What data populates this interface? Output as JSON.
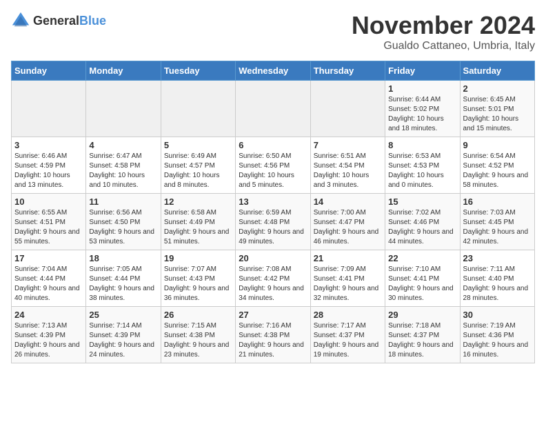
{
  "logo": {
    "general": "General",
    "blue": "Blue"
  },
  "title": "November 2024",
  "location": "Gualdo Cattaneo, Umbria, Italy",
  "days_of_week": [
    "Sunday",
    "Monday",
    "Tuesday",
    "Wednesday",
    "Thursday",
    "Friday",
    "Saturday"
  ],
  "weeks": [
    [
      {
        "day": "",
        "info": ""
      },
      {
        "day": "",
        "info": ""
      },
      {
        "day": "",
        "info": ""
      },
      {
        "day": "",
        "info": ""
      },
      {
        "day": "",
        "info": ""
      },
      {
        "day": "1",
        "info": "Sunrise: 6:44 AM\nSunset: 5:02 PM\nDaylight: 10 hours and 18 minutes."
      },
      {
        "day": "2",
        "info": "Sunrise: 6:45 AM\nSunset: 5:01 PM\nDaylight: 10 hours and 15 minutes."
      }
    ],
    [
      {
        "day": "3",
        "info": "Sunrise: 6:46 AM\nSunset: 4:59 PM\nDaylight: 10 hours and 13 minutes."
      },
      {
        "day": "4",
        "info": "Sunrise: 6:47 AM\nSunset: 4:58 PM\nDaylight: 10 hours and 10 minutes."
      },
      {
        "day": "5",
        "info": "Sunrise: 6:49 AM\nSunset: 4:57 PM\nDaylight: 10 hours and 8 minutes."
      },
      {
        "day": "6",
        "info": "Sunrise: 6:50 AM\nSunset: 4:56 PM\nDaylight: 10 hours and 5 minutes."
      },
      {
        "day": "7",
        "info": "Sunrise: 6:51 AM\nSunset: 4:54 PM\nDaylight: 10 hours and 3 minutes."
      },
      {
        "day": "8",
        "info": "Sunrise: 6:53 AM\nSunset: 4:53 PM\nDaylight: 10 hours and 0 minutes."
      },
      {
        "day": "9",
        "info": "Sunrise: 6:54 AM\nSunset: 4:52 PM\nDaylight: 9 hours and 58 minutes."
      }
    ],
    [
      {
        "day": "10",
        "info": "Sunrise: 6:55 AM\nSunset: 4:51 PM\nDaylight: 9 hours and 55 minutes."
      },
      {
        "day": "11",
        "info": "Sunrise: 6:56 AM\nSunset: 4:50 PM\nDaylight: 9 hours and 53 minutes."
      },
      {
        "day": "12",
        "info": "Sunrise: 6:58 AM\nSunset: 4:49 PM\nDaylight: 9 hours and 51 minutes."
      },
      {
        "day": "13",
        "info": "Sunrise: 6:59 AM\nSunset: 4:48 PM\nDaylight: 9 hours and 49 minutes."
      },
      {
        "day": "14",
        "info": "Sunrise: 7:00 AM\nSunset: 4:47 PM\nDaylight: 9 hours and 46 minutes."
      },
      {
        "day": "15",
        "info": "Sunrise: 7:02 AM\nSunset: 4:46 PM\nDaylight: 9 hours and 44 minutes."
      },
      {
        "day": "16",
        "info": "Sunrise: 7:03 AM\nSunset: 4:45 PM\nDaylight: 9 hours and 42 minutes."
      }
    ],
    [
      {
        "day": "17",
        "info": "Sunrise: 7:04 AM\nSunset: 4:44 PM\nDaylight: 9 hours and 40 minutes."
      },
      {
        "day": "18",
        "info": "Sunrise: 7:05 AM\nSunset: 4:44 PM\nDaylight: 9 hours and 38 minutes."
      },
      {
        "day": "19",
        "info": "Sunrise: 7:07 AM\nSunset: 4:43 PM\nDaylight: 9 hours and 36 minutes."
      },
      {
        "day": "20",
        "info": "Sunrise: 7:08 AM\nSunset: 4:42 PM\nDaylight: 9 hours and 34 minutes."
      },
      {
        "day": "21",
        "info": "Sunrise: 7:09 AM\nSunset: 4:41 PM\nDaylight: 9 hours and 32 minutes."
      },
      {
        "day": "22",
        "info": "Sunrise: 7:10 AM\nSunset: 4:41 PM\nDaylight: 9 hours and 30 minutes."
      },
      {
        "day": "23",
        "info": "Sunrise: 7:11 AM\nSunset: 4:40 PM\nDaylight: 9 hours and 28 minutes."
      }
    ],
    [
      {
        "day": "24",
        "info": "Sunrise: 7:13 AM\nSunset: 4:39 PM\nDaylight: 9 hours and 26 minutes."
      },
      {
        "day": "25",
        "info": "Sunrise: 7:14 AM\nSunset: 4:39 PM\nDaylight: 9 hours and 24 minutes."
      },
      {
        "day": "26",
        "info": "Sunrise: 7:15 AM\nSunset: 4:38 PM\nDaylight: 9 hours and 23 minutes."
      },
      {
        "day": "27",
        "info": "Sunrise: 7:16 AM\nSunset: 4:38 PM\nDaylight: 9 hours and 21 minutes."
      },
      {
        "day": "28",
        "info": "Sunrise: 7:17 AM\nSunset: 4:37 PM\nDaylight: 9 hours and 19 minutes."
      },
      {
        "day": "29",
        "info": "Sunrise: 7:18 AM\nSunset: 4:37 PM\nDaylight: 9 hours and 18 minutes."
      },
      {
        "day": "30",
        "info": "Sunrise: 7:19 AM\nSunset: 4:36 PM\nDaylight: 9 hours and 16 minutes."
      }
    ]
  ]
}
